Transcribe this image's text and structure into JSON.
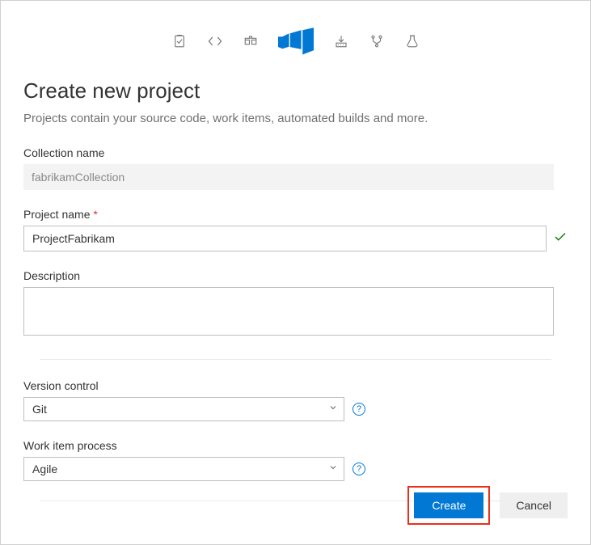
{
  "header": {
    "title": "Create new project",
    "subtitle": "Projects contain your source code, work items, automated builds and more."
  },
  "fields": {
    "collection": {
      "label": "Collection name",
      "value": "fabrikamCollection"
    },
    "project": {
      "label": "Project name",
      "value": "ProjectFabrikam"
    },
    "description": {
      "label": "Description",
      "value": ""
    },
    "version_control": {
      "label": "Version control",
      "value": "Git"
    },
    "work_item_process": {
      "label": "Work item process",
      "value": "Agile"
    }
  },
  "buttons": {
    "create": "Create",
    "cancel": "Cancel"
  },
  "required_marker": "*",
  "info_glyph": "?"
}
